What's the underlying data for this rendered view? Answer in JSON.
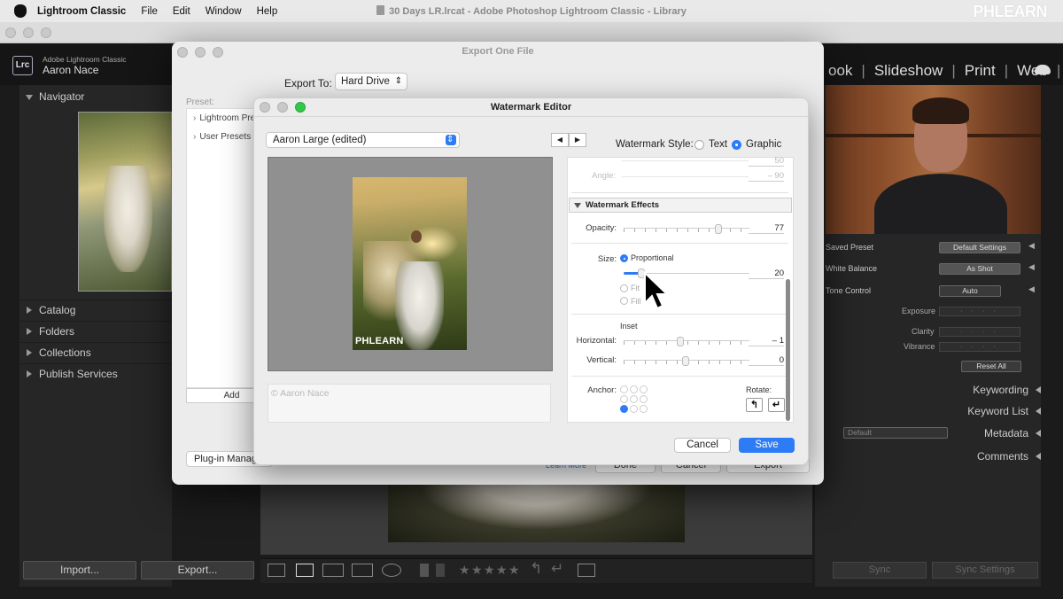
{
  "menubar": {
    "app_name": "Lightroom Classic",
    "items": [
      "File",
      "Edit",
      "Window",
      "Help"
    ],
    "watermark_logo": "PHLEARN"
  },
  "main_window": {
    "title": "30 Days LR.lrcat - Adobe Photoshop Lightroom Classic - Library",
    "app_badge": "Lrc",
    "app_small_name": "Adobe Lightroom Classic",
    "user_name": "Aaron Nace",
    "modules": [
      "ook",
      "Slideshow",
      "Print",
      "Web"
    ]
  },
  "left_panel": {
    "navigator": "Navigator",
    "sections": [
      "Catalog",
      "Folders",
      "Collections",
      "Publish Services"
    ],
    "import_label": "Import...",
    "export_label": "Export..."
  },
  "right_panel": {
    "saved_preset_label": "Saved Preset",
    "saved_preset_value": "Default Settings",
    "white_balance_label": "White Balance",
    "white_balance_value": "As Shot",
    "tone_control_label": "Tone Control",
    "auto_label": "Auto",
    "exposure_label": "Exposure",
    "clarity_label": "Clarity",
    "vibrance_label": "Vibrance",
    "reset_all_label": "Reset All",
    "keywording": "Keywording",
    "keyword_list": "Keyword List",
    "metadata": "Metadata",
    "metadata_preset": "Default",
    "comments": "Comments",
    "sync_label": "Sync",
    "sync_settings_label": "Sync Settings"
  },
  "export_dialog": {
    "title": "Export One File",
    "export_to_label": "Export To:",
    "export_to_value": "Hard Drive",
    "preset_label": "Preset:",
    "presets": [
      "Lightroom Pre",
      "User Presets"
    ],
    "add_label": "Add",
    "plugin_label": "Plug-in Manag",
    "learn_more": "Learn More",
    "done_label": "Done",
    "cancel_label": "Cancel",
    "export_label": "Export"
  },
  "watermark_editor": {
    "title": "Watermark Editor",
    "preset_value": "Aaron Large (edited)",
    "prev_arrow": "◀",
    "next_arrow": "▶",
    "style_label": "Watermark Style:",
    "style_text": "Text",
    "style_graphic": "Graphic",
    "selected_style": "Graphic",
    "watermark_overlay": "PHLEARN",
    "text_field_value": "Aaron Nace",
    "text_field_symbol": "©",
    "angle_label": "Angle:",
    "angle_value": "– 90",
    "radius_value": "50",
    "effects_header": "Watermark Effects",
    "opacity_label": "Opacity:",
    "opacity_value": "77",
    "size_label": "Size:",
    "size_proportional": "Proportional",
    "size_fit": "Fit",
    "size_fill": "Fill",
    "size_value": "20",
    "inset_label": "Inset",
    "horizontal_label": "Horizontal:",
    "horizontal_value": "– 1",
    "vertical_label": "Vertical:",
    "vertical_value": "0",
    "anchor_label": "Anchor:",
    "rotate_label": "Rotate:",
    "rotate_left": "↰",
    "rotate_right": "↵",
    "cancel_label": "Cancel",
    "save_label": "Save"
  }
}
